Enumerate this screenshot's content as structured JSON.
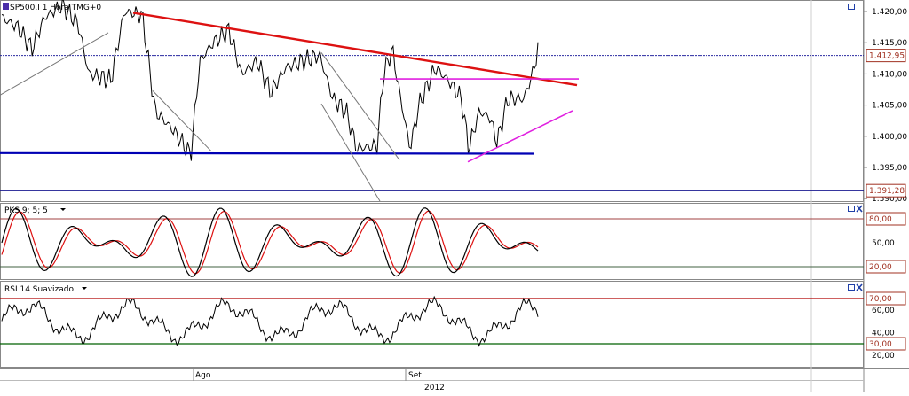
{
  "chart_data": [
    {
      "type": "line",
      "title": "SP500.I 1 Hora TMG+0",
      "price_axis": {
        "ticks": [
          "1.420,00",
          "1.415,00",
          "1.410,00",
          "1.405,00",
          "1.400,00",
          "1.395,00",
          "1.390,00"
        ],
        "tick_values": [
          1420,
          1415,
          1410,
          1405,
          1400,
          1395,
          1390
        ],
        "ylim": [
          1389.5,
          1421.5
        ]
      },
      "last_price_label": "1.412,95",
      "last_price": 1412.95,
      "support_label": "1.391,28",
      "support_price": 1391.28,
      "grid": false,
      "colors": {
        "price": "#000000",
        "resistance": "#dd1111",
        "support": "#0000b4",
        "triangle": "#e020e0",
        "channel": "#777777"
      }
    },
    {
      "type": "line",
      "title": "PKS 9; 5; 5",
      "ticks": [
        "80,00",
        "50,00",
        "20,00"
      ],
      "tick_values": [
        80,
        50,
        20
      ],
      "ylim": [
        0,
        100
      ],
      "levels": [
        80,
        20
      ],
      "colors": {
        "fast": "#000000",
        "slow": "#dd1111"
      }
    },
    {
      "type": "line",
      "title": "RSI 14 Suavizado",
      "ticks": [
        "70,00",
        "60,00",
        "40,00",
        "30,00",
        "20,00"
      ],
      "tick_values": [
        70,
        60,
        40,
        30,
        20
      ],
      "ylim": [
        15,
        80
      ],
      "levels": [
        70,
        30
      ],
      "colors": {
        "rsi": "#000000",
        "upper": "#b00000",
        "lower": "#006000"
      }
    }
  ],
  "time_axis": {
    "labels": [
      "Ago",
      "Set"
    ],
    "year": "2012"
  },
  "window_icons": {
    "maximize": "maximize-icon",
    "close": "close-icon"
  }
}
